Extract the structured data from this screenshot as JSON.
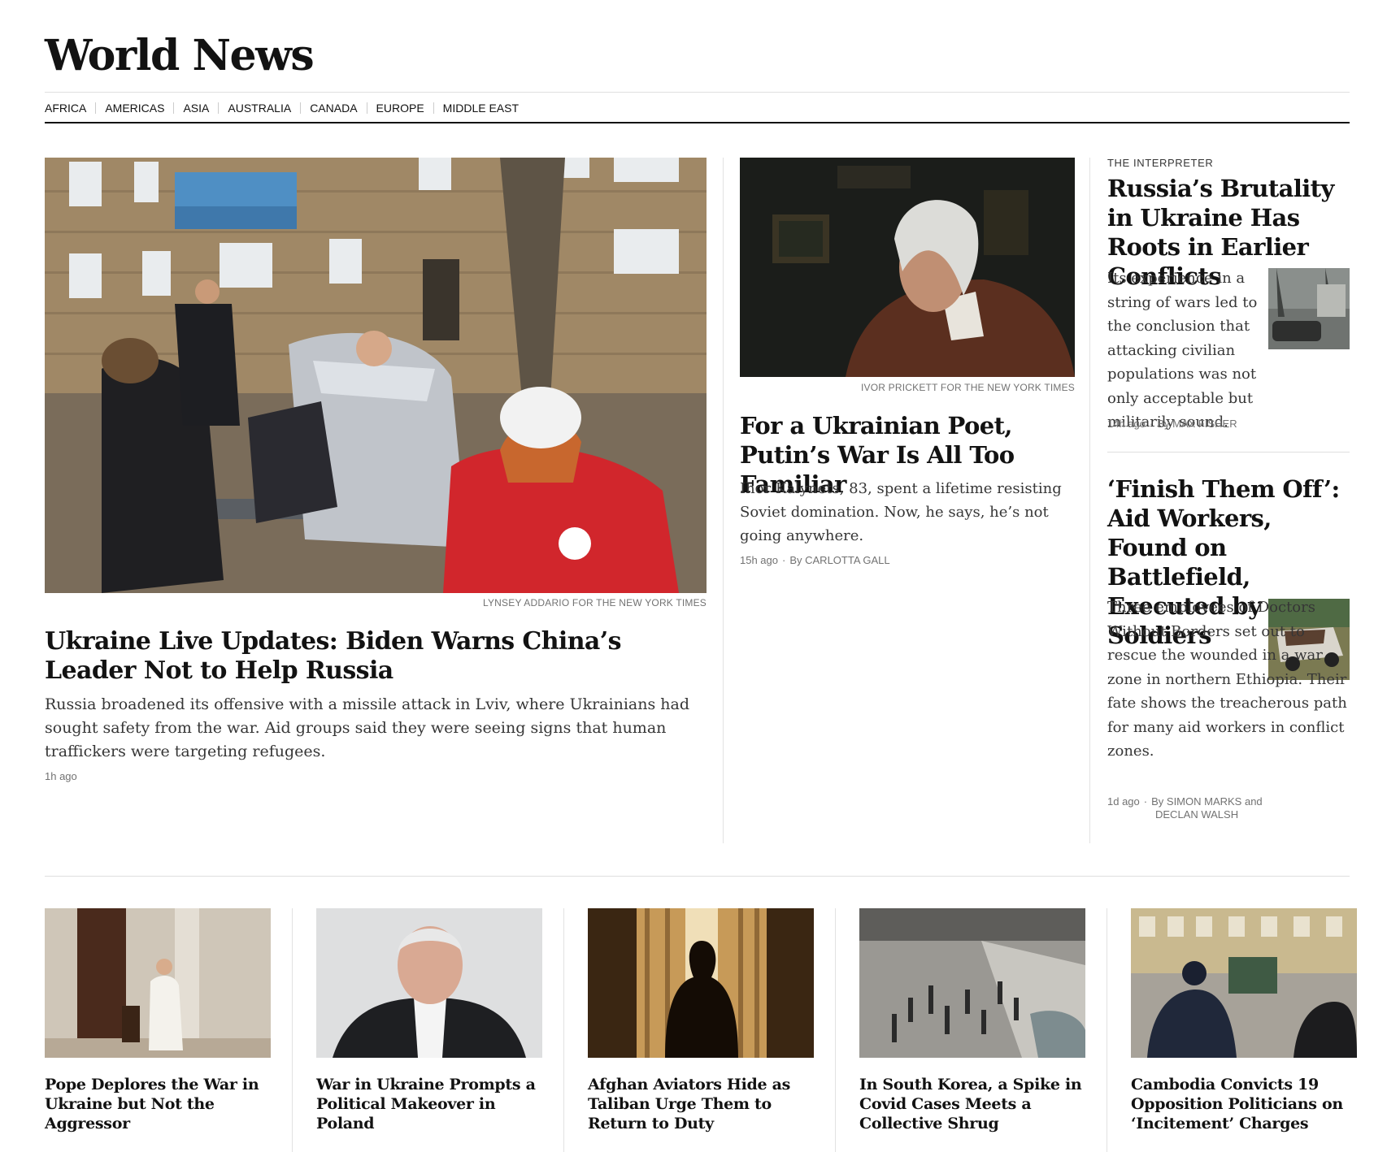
{
  "section": {
    "title": "World News"
  },
  "nav": {
    "items": [
      "AFRICA",
      "AMERICAS",
      "ASIA",
      "AUSTRALIA",
      "CANADA",
      "EUROPE",
      "MIDDLE EAST"
    ]
  },
  "lead": {
    "credit": "LYNSEY ADDARIO FOR THE NEW YORK TIMES",
    "headline": "Ukraine Live Updates: Biden Warns China’s Leader Not to Help Russia",
    "summary": "Russia broadened its offensive with a missile attack in Lviv, where Ukrainians had sought safety from the war. Aid groups said they were seeing signs that human traffickers were targeting refugees.",
    "time": "1h ago"
  },
  "second": {
    "credit": "IVOR PRICKETT FOR THE NEW YORK TIMES",
    "headline": "For a Ukrainian Poet, Putin’s War Is All Too Familiar",
    "summary": "Ihor Kalynets, 83, spent a lifetime resisting Soviet domination. Now, he says, he’s not going anywhere.",
    "time": "15h ago",
    "byline": "By CARLOTTA GALL"
  },
  "interpreter": {
    "kicker": "THE INTERPRETER",
    "headline": "Russia’s Brutality in Ukraine Has Roots in Earlier Conflicts",
    "summary": "Its experience in a string of wars led to the conclusion that attacking civilian populations was not only acceptable but militarily sound.",
    "time": "14h ago",
    "byline": "By MAX FISHER"
  },
  "finish": {
    "headline": "‘Finish Them Off’: Aid Workers, Found on Battlefield, Executed by Soldiers",
    "summary": "Three employees of Doctors Without Borders set out to rescue the wounded in a war zone in northern Ethiopia. Their fate shows the treacherous path for many aid workers in conflict zones.",
    "time": "1d ago",
    "byline_1": "By SIMON MARKS and",
    "byline_2": "DECLAN WALSH"
  },
  "bottom": [
    {
      "title": "Pope Deplores the War in Ukraine but Not the Aggressor"
    },
    {
      "title": "War in Ukraine Prompts a Political Makeover in Poland"
    },
    {
      "title": "Afghan Aviators Hide as Taliban Urge Them to Return to Duty"
    },
    {
      "title": "In South Korea, a Spike in Covid Cases Meets a Collective Shrug"
    },
    {
      "title": "Cambodia Convicts 19 Opposition Politicians on ‘Incitement’ Charges"
    }
  ]
}
